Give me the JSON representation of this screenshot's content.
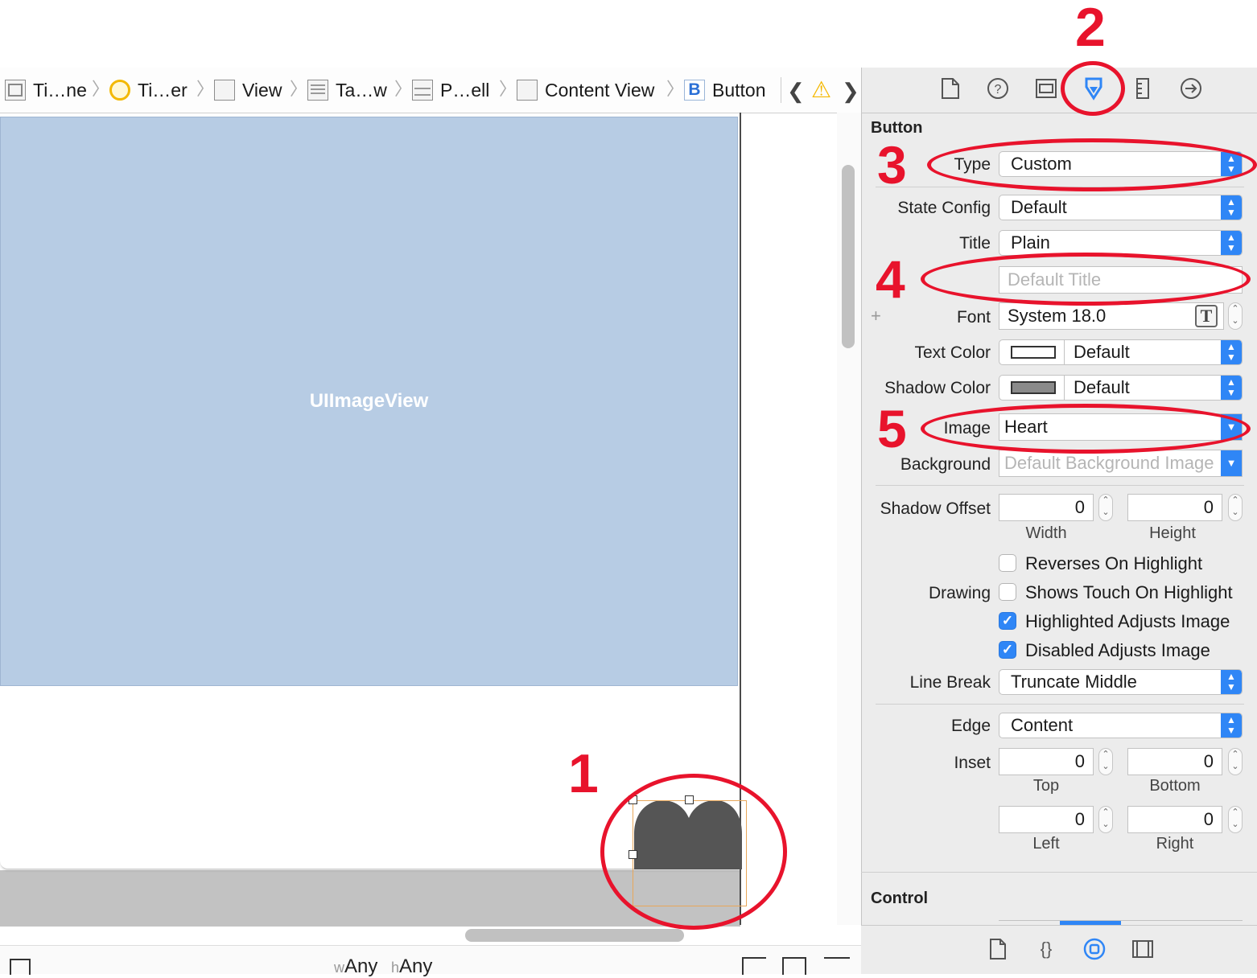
{
  "breadcrumb": {
    "items": [
      {
        "label": "Ti…ne",
        "icon": "storyboard-icon"
      },
      {
        "label": "Ti…er",
        "icon": "view-controller-icon"
      },
      {
        "label": "View",
        "icon": "view-icon"
      },
      {
        "label": "Ta…w",
        "icon": "table-view-icon"
      },
      {
        "label": "P…ell",
        "icon": "table-cell-icon"
      },
      {
        "label": "Content View",
        "icon": "view-icon"
      },
      {
        "label": "Button",
        "icon": "button-icon",
        "icon_text": "B"
      }
    ],
    "back": "❮",
    "forward": "❯",
    "warning": "⚠"
  },
  "canvas": {
    "imageview_label": "UIImageView",
    "size_class_w": "w",
    "size_class_w_value": "Any",
    "size_class_h": "h",
    "size_class_h_value": "Any"
  },
  "annotations": {
    "n1": "1",
    "n2": "2",
    "n3": "3",
    "n4": "4",
    "n5": "5"
  },
  "inspector": {
    "tabs": [
      "file-inspector-icon",
      "quick-help-icon",
      "identity-inspector-icon",
      "attributes-inspector-icon",
      "size-inspector-icon",
      "connections-inspector-icon"
    ],
    "section_title": "Button",
    "type_label": "Type",
    "type_value": "Custom",
    "state_config_label": "State Config",
    "state_config_value": "Default",
    "title_label": "Title",
    "title_value": "Plain",
    "title_placeholder": "Default Title",
    "font_label": "Font",
    "font_value": "System 18.0",
    "font_plus": "+",
    "text_color_label": "Text Color",
    "text_color_value": "Default",
    "shadow_color_label": "Shadow Color",
    "shadow_color_value": "Default",
    "image_label": "Image",
    "image_value": "Heart",
    "background_label": "Background",
    "background_placeholder": "Default Background Image",
    "shadow_offset_label": "Shadow Offset",
    "shadow_width": "0",
    "shadow_height": "0",
    "width_caption": "Width",
    "height_caption": "Height",
    "drawing_label": "Drawing",
    "reverses": "Reverses On Highlight",
    "shows_touch": "Shows Touch On Highlight",
    "highlighted_adjusts": "Highlighted Adjusts Image",
    "disabled_adjusts": "Disabled Adjusts Image",
    "line_break_label": "Line Break",
    "line_break_value": "Truncate Middle",
    "edge_label": "Edge",
    "edge_value": "Content",
    "inset_label": "Inset",
    "inset_top": "0",
    "inset_bottom": "0",
    "inset_left": "0",
    "inset_right": "0",
    "top_caption": "Top",
    "bottom_caption": "Bottom",
    "left_caption": "Left",
    "right_caption": "Right",
    "control_title": "Control"
  },
  "library_tabs": [
    "file-template-icon",
    "code-snippet-icon",
    "object-library-icon",
    "media-library-icon"
  ],
  "colors": {
    "accent": "#2f86f6",
    "annotation": "#e8132c",
    "imageview_bg": "#b7cce4",
    "heart": "#555555"
  }
}
